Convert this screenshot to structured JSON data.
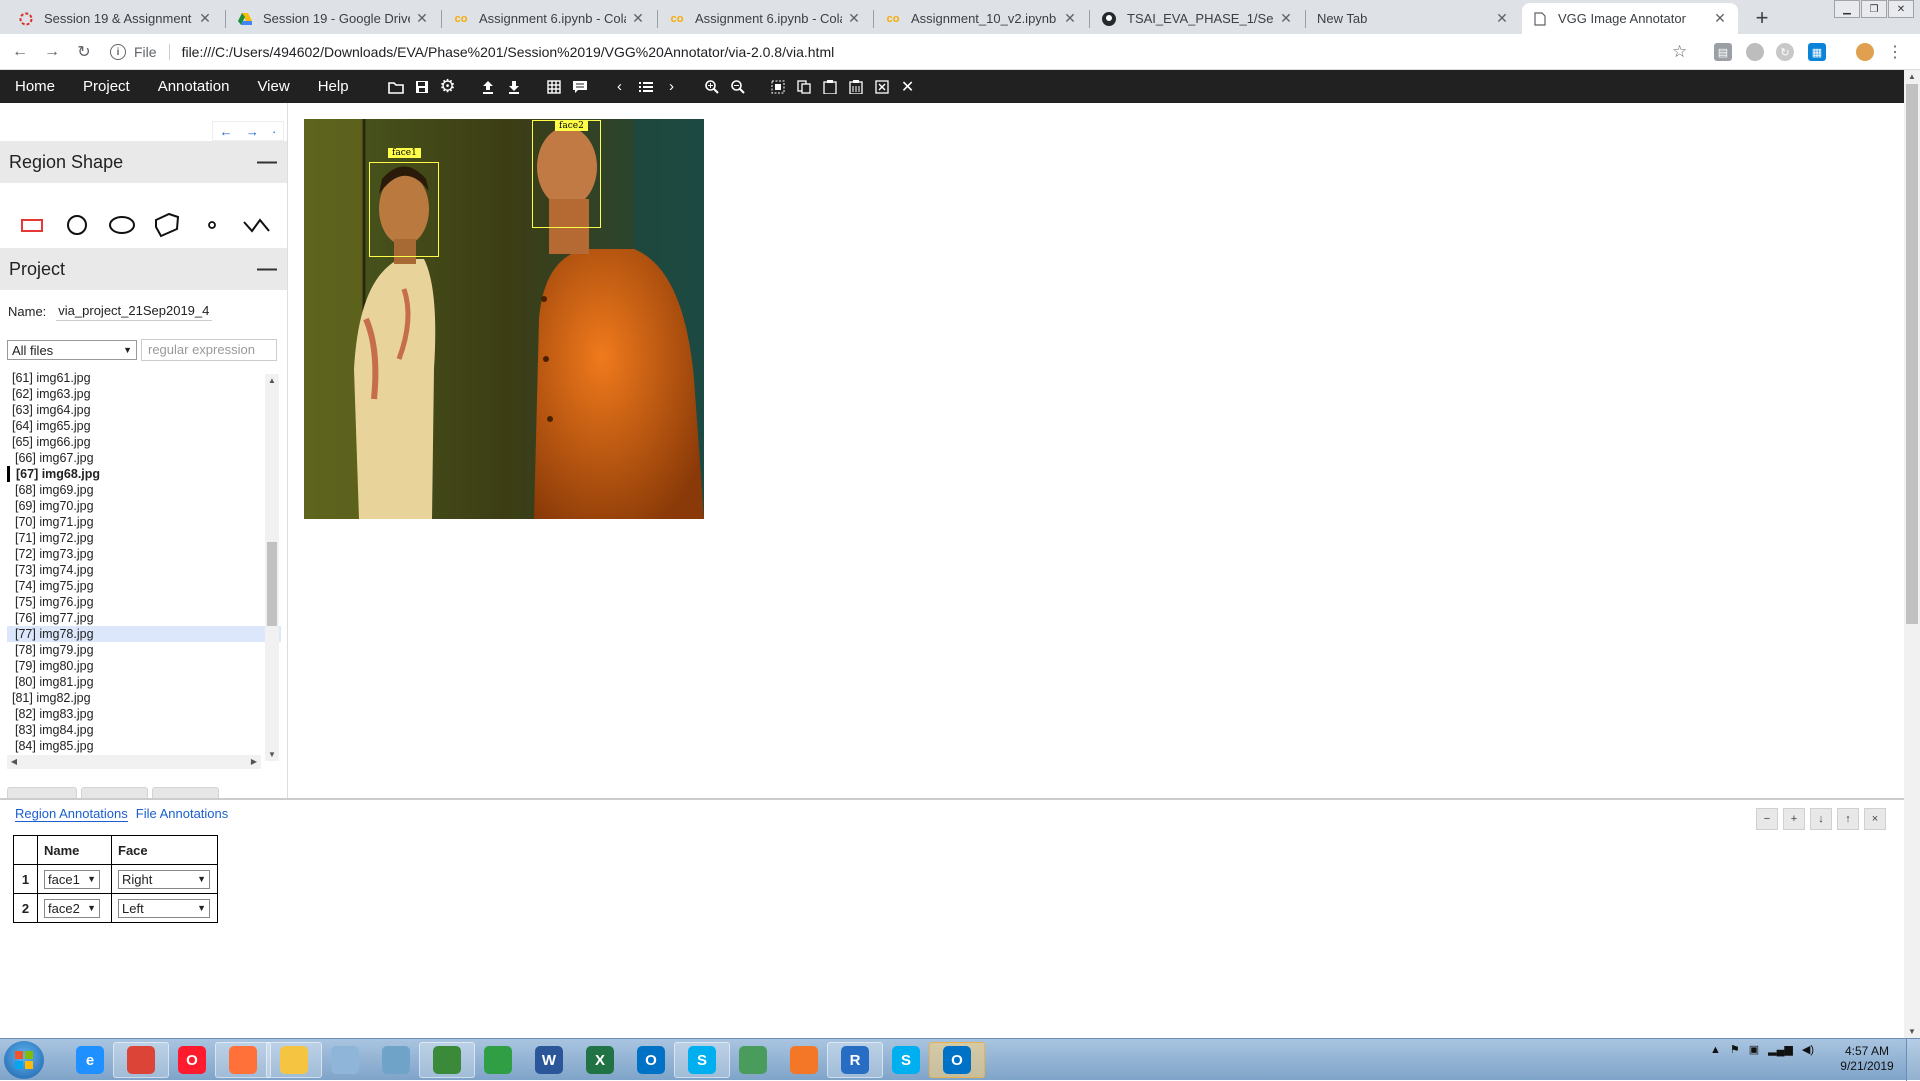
{
  "browser": {
    "tabs": [
      {
        "title": "Session 19 & Assignment",
        "icon": "session-icon",
        "color": "#d93025"
      },
      {
        "title": "Session 19 - Google Drive",
        "icon": "google-drive-icon",
        "color": "#1e8e3e"
      },
      {
        "title": "Assignment 6.ipynb - Colab",
        "icon": "colab-icon",
        "color": "#f9ab00"
      },
      {
        "title": "Assignment 6.ipynb - Colab",
        "icon": "colab-icon",
        "color": "#f9ab00"
      },
      {
        "title": "Assignment_10_v2.ipynb - C",
        "icon": "colab-icon",
        "color": "#f9ab00"
      },
      {
        "title": "TSAI_EVA_PHASE_1/Session",
        "icon": "github-icon",
        "color": "#24292e"
      },
      {
        "title": "New Tab",
        "icon": "",
        "color": ""
      },
      {
        "title": "VGG Image Annotator",
        "icon": "page-icon",
        "color": "#5f6368"
      }
    ],
    "new_tab": "+",
    "address": {
      "scheme": "File",
      "url": "file:///C:/Users/494602/Downloads/EVA/Phase%201/Session%2019/VGG%20Annotator/via-2.0.8/via.html"
    }
  },
  "via": {
    "menu": [
      "Home",
      "Project",
      "Annotation",
      "View",
      "Help"
    ],
    "toolbar_icons": [
      "open-folder-icon",
      "save-icon",
      "settings-icon",
      "upload-icon",
      "download-icon",
      "grid-view-icon",
      "comment-icon",
      "prev-image-icon",
      "list-icon",
      "next-image-icon",
      "zoom-in-icon",
      "zoom-out-icon",
      "select-all-icon",
      "copy-icon",
      "paste-icon",
      "paste-special-icon",
      "delete-region-icon",
      "close-icon"
    ],
    "panel_arrows": [
      "←",
      "→",
      "·"
    ],
    "region_shape": {
      "title": "Region Shape",
      "collapse": "—",
      "shapes": [
        "rectangle",
        "circle",
        "ellipse",
        "polygon",
        "point",
        "polyline"
      ],
      "selected": "rectangle",
      "selected_color": "#e53935"
    },
    "project": {
      "title": "Project",
      "collapse": "—",
      "name_label": "Name:",
      "name_value": "via_project_21Sep2019_4",
      "filter_value": "All files",
      "regex_placeholder": "regular expression",
      "files": [
        {
          "label": "[61] img61.jpg",
          "indent": false
        },
        {
          "label": "[62] img63.jpg",
          "indent": false
        },
        {
          "label": "[63] img64.jpg",
          "indent": false
        },
        {
          "label": "[64] img65.jpg",
          "indent": false
        },
        {
          "label": "[65] img66.jpg",
          "indent": false
        },
        {
          "label": "[66] img67.jpg",
          "indent": true
        },
        {
          "label": "[67] img68.jpg",
          "indent": false,
          "current": true
        },
        {
          "label": "[68] img69.jpg",
          "indent": true
        },
        {
          "label": "[69] img70.jpg",
          "indent": true
        },
        {
          "label": "[70] img71.jpg",
          "indent": true
        },
        {
          "label": "[71] img72.jpg",
          "indent": true
        },
        {
          "label": "[72] img73.jpg",
          "indent": true
        },
        {
          "label": "[73] img74.jpg",
          "indent": true
        },
        {
          "label": "[74] img75.jpg",
          "indent": true
        },
        {
          "label": "[75] img76.jpg",
          "indent": true
        },
        {
          "label": "[76] img77.jpg",
          "indent": true
        },
        {
          "label": "[77] img78.jpg",
          "indent": true,
          "selected": true
        },
        {
          "label": "[78] img79.jpg",
          "indent": true
        },
        {
          "label": "[79] img80.jpg",
          "indent": true
        },
        {
          "label": "[80] img81.jpg",
          "indent": true
        },
        {
          "label": "[81] img82.jpg",
          "indent": false
        },
        {
          "label": "[82] img83.jpg",
          "indent": true
        },
        {
          "label": "[83] img84.jpg",
          "indent": true
        },
        {
          "label": "[84] img85.jpg",
          "indent": true
        }
      ],
      "list_scroll_position": 0.56
    },
    "regions": [
      {
        "label": "face1"
      },
      {
        "label": "face2"
      }
    ],
    "editor": {
      "tabs": [
        "Region Annotations",
        "File Annotations"
      ],
      "controls": [
        "−",
        "+",
        "↓",
        "↑",
        "×"
      ],
      "columns": [
        "Name",
        "Face"
      ],
      "rows": [
        {
          "idx": "1",
          "name": "face1",
          "face": "Right"
        },
        {
          "idx": "2",
          "name": "face2",
          "face": "Left"
        }
      ]
    }
  },
  "taskbar": {
    "apps": [
      {
        "name": "internet-explorer-icon",
        "glyph": "e",
        "color": "#1e90ff",
        "open": false
      },
      {
        "name": "chrome-icon",
        "glyph": "",
        "color": "#db4437",
        "open": true
      },
      {
        "name": "opera-icon",
        "glyph": "O",
        "color": "#ff1b2d",
        "open": false
      },
      {
        "name": "firefox-icon",
        "glyph": "",
        "color": "#ff7139",
        "open": true
      },
      {
        "name": "file-explorer-icon",
        "glyph": "",
        "color": "#f5c542",
        "open": true
      },
      {
        "name": "calculator-icon",
        "glyph": "",
        "color": "#8fb6d9",
        "open": false
      },
      {
        "name": "notepad-icon",
        "glyph": "",
        "color": "#6fa3c7",
        "open": false
      },
      {
        "name": "paint-icon",
        "glyph": "",
        "color": "#3a8a3a",
        "open": true
      },
      {
        "name": "green-app-icon",
        "glyph": "",
        "color": "#2f9e44",
        "open": false
      },
      {
        "name": "word-icon",
        "glyph": "W",
        "color": "#2b579a",
        "open": false
      },
      {
        "name": "excel-icon",
        "glyph": "X",
        "color": "#217346",
        "open": false
      },
      {
        "name": "outlook-icon",
        "glyph": "O",
        "color": "#0072c6",
        "open": false
      },
      {
        "name": "skype-business-icon",
        "glyph": "S",
        "color": "#00aff0",
        "open": true
      },
      {
        "name": "globe-app-icon",
        "glyph": "",
        "color": "#4a9c5d",
        "open": false
      },
      {
        "name": "jupyter-icon",
        "glyph": "",
        "color": "#f37726",
        "open": false
      },
      {
        "name": "r-icon",
        "glyph": "R",
        "color": "#276dc3",
        "open": true
      },
      {
        "name": "skype-icon",
        "glyph": "S",
        "color": "#00aff0",
        "open": false
      },
      {
        "name": "outlook-open-icon",
        "glyph": "O",
        "color": "#0072c6",
        "open": true,
        "active": true
      }
    ],
    "time": "4:57 AM",
    "date": "9/21/2019"
  }
}
